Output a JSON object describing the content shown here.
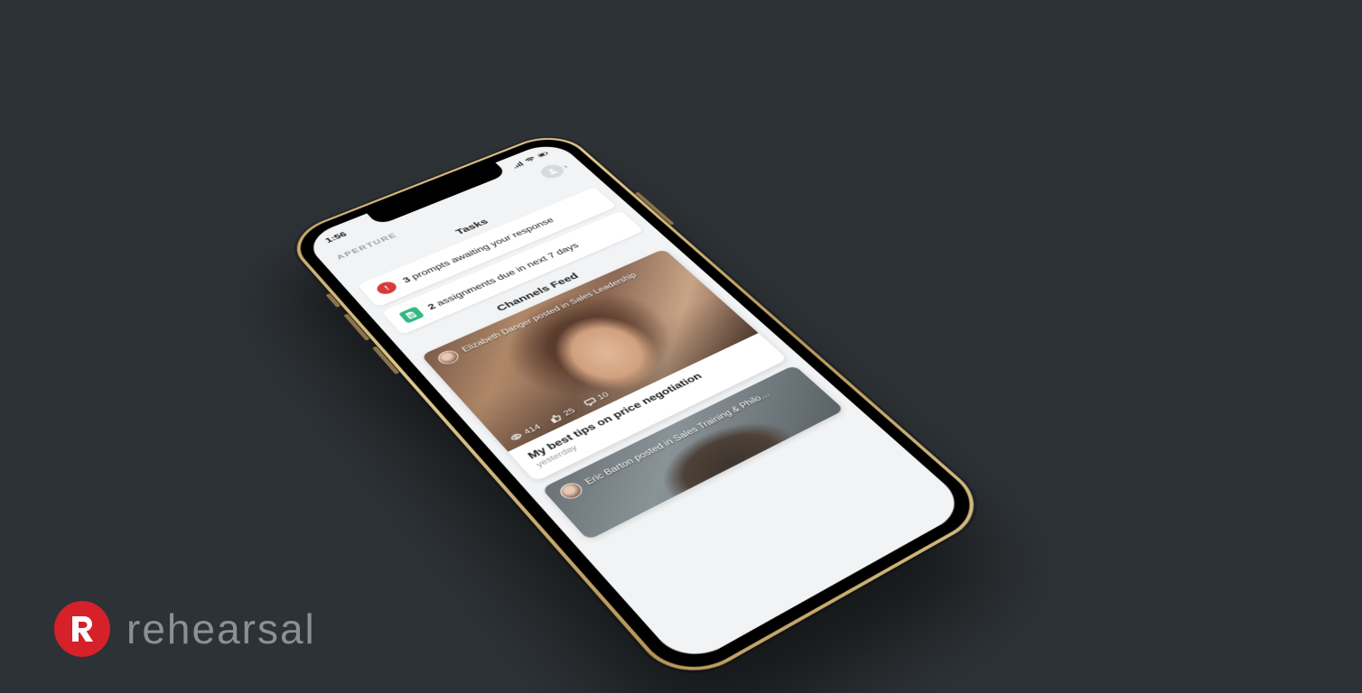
{
  "brand": {
    "wordmark": "rehearsal"
  },
  "status_bar": {
    "time": "1:56"
  },
  "header": {
    "org_label": "APERTURE"
  },
  "tasks": {
    "section_title": "Tasks",
    "items": [
      {
        "count": "3",
        "text_after": " prompts awaiting your response",
        "icon": "alert-icon",
        "color": "red"
      },
      {
        "count": "2",
        "text_after": " assignments due in next 7 days",
        "icon": "document-icon",
        "color": "green"
      }
    ]
  },
  "feed": {
    "section_title": "Channels Feed",
    "posts": [
      {
        "author": "Elizabeth Danger",
        "channel": "Sales Leadership",
        "byline": "Elizabeth Danger posted in Sales Leadership",
        "title": "My best tips on price negotiation",
        "time": "yesterday",
        "stats": {
          "views": "414",
          "likes": "25",
          "comments": "10"
        }
      },
      {
        "author": "Eric Barton",
        "channel": "Sales Training & Philo…",
        "byline": "Eric Barton posted in Sales Training & Philo…"
      }
    ]
  }
}
